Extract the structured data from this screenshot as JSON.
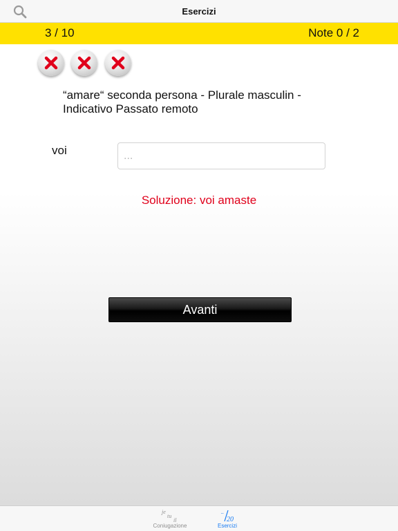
{
  "header": {
    "title": "Esercizi",
    "search_icon": "search-icon"
  },
  "status_bar": {
    "progress": "3 / 10",
    "score": "Note 0 / 2",
    "background_color": "#ffe100"
  },
  "lives": {
    "icon": "close-icon",
    "icon_color": "#e0001b",
    "count": 3
  },
  "exercise": {
    "prompt_line_1": "“amare“  seconda persona - Plurale masculin -",
    "prompt_line_2": "Indicativo Passato remoto",
    "pronoun": "voi",
    "answer_value": "",
    "answer_placeholder": "...",
    "solution": "Soluzione: voi amaste",
    "solution_color": "#e0001b",
    "next_label": "Avanti"
  },
  "tabs": [
    {
      "label": "Coniugazione",
      "icon": "conjugation-icon",
      "selected": false
    },
    {
      "label": "Esercizi",
      "icon": "exercises-icon",
      "selected": true
    }
  ],
  "accent_color": "#1a7cf2"
}
